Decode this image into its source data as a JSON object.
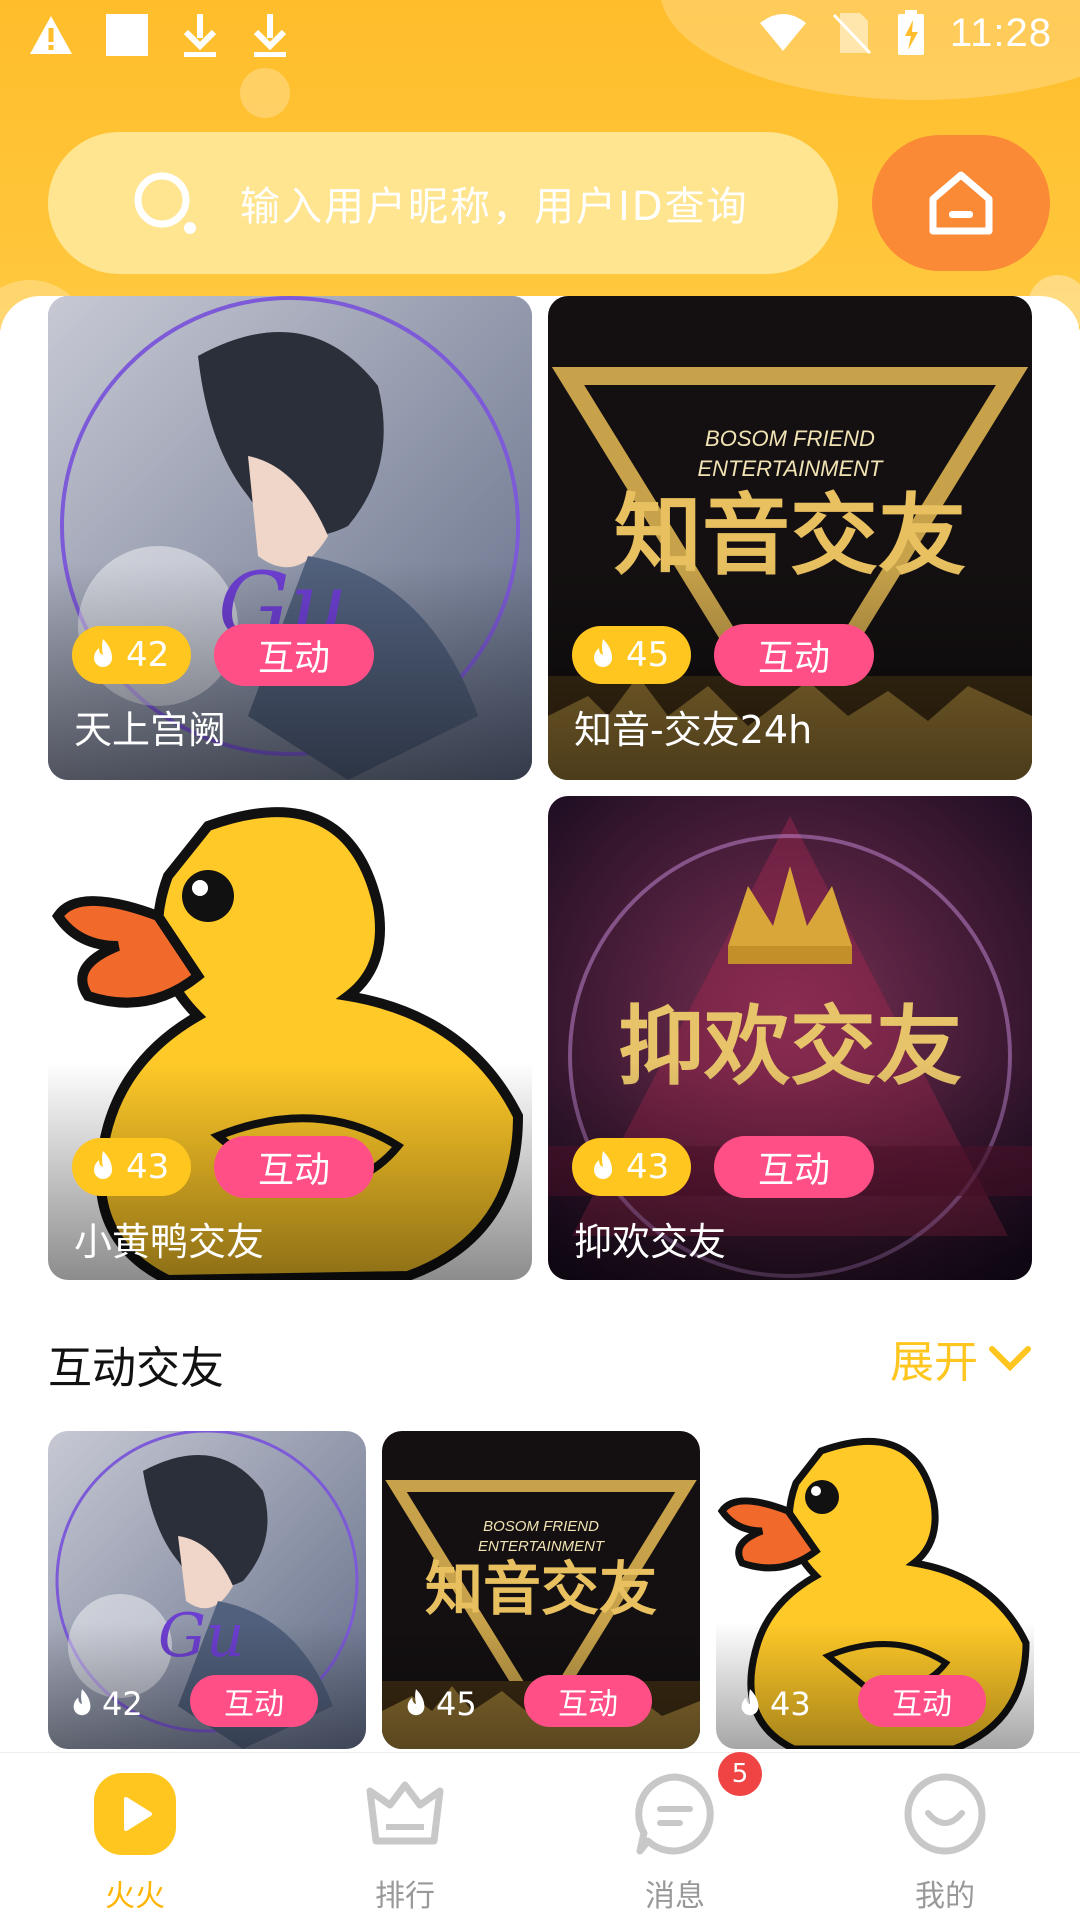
{
  "status_bar": {
    "time": "11:28"
  },
  "search": {
    "placeholder": "输入用户昵称，用户ID查询"
  },
  "featured": [
    {
      "name": "天上宫阙",
      "heat": "42",
      "tag": "互动",
      "art": "anime-boy"
    },
    {
      "name": "知音-交友24h",
      "heat": "45",
      "tag": "互动",
      "art": "gold-poster",
      "art_text": [
        "BOSOM FRIEND",
        "ENTERTAINMENT",
        "知音交友"
      ]
    },
    {
      "name": "小黄鸭交友",
      "heat": "43",
      "tag": "互动",
      "art": "duck"
    },
    {
      "name": "抑欢交友",
      "heat": "43",
      "tag": "互动",
      "art": "crown-poster",
      "art_text": [
        "抑欢交友"
      ]
    }
  ],
  "section": {
    "title": "互动交友",
    "more_label": "展开"
  },
  "interactive": [
    {
      "heat": "42",
      "tag": "互动",
      "art": "anime-boy"
    },
    {
      "heat": "45",
      "tag": "互动",
      "art": "gold-poster",
      "art_text": [
        "BOSOM FRIEND",
        "ENTERTAINMENT",
        "知音交友"
      ]
    },
    {
      "heat": "43",
      "tag": "互动",
      "art": "duck"
    }
  ],
  "nav": [
    {
      "label": "火火",
      "icon": "play-icon",
      "active": true
    },
    {
      "label": "排行",
      "icon": "crown-icon",
      "active": false
    },
    {
      "label": "消息",
      "icon": "message-icon",
      "active": false,
      "badge": "5"
    },
    {
      "label": "我的",
      "icon": "smile-icon",
      "active": false
    }
  ],
  "colors": {
    "brand_yellow": "#FFC61F",
    "tag_pink": "#FF4F86",
    "home_orange": "#FA8A36"
  }
}
